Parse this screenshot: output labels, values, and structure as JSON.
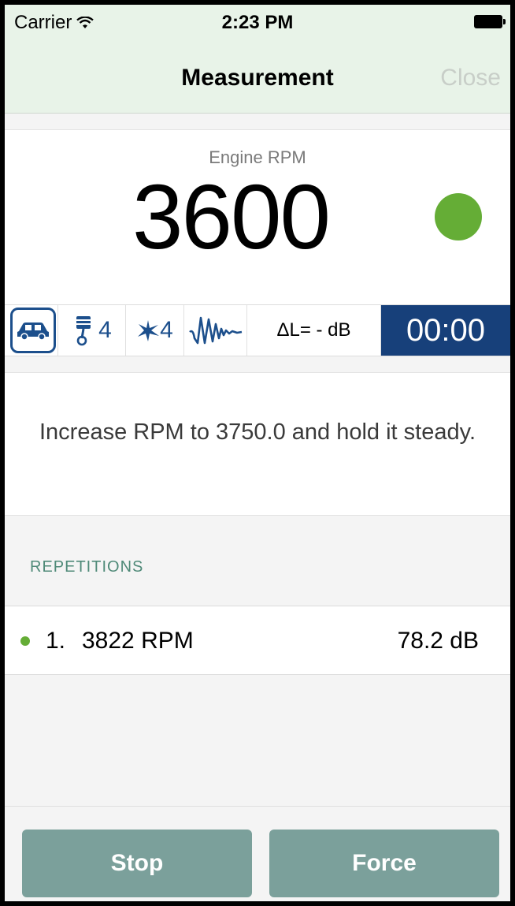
{
  "status_bar": {
    "carrier": "Carrier",
    "time": "2:23 PM"
  },
  "nav": {
    "title": "Measurement",
    "close_label": "Close"
  },
  "engine": {
    "label": "Engine RPM",
    "value": "3600",
    "status_color": "#65ad36"
  },
  "toolbar": {
    "vehicle_icon": "car-icon",
    "cylinders": "4",
    "cylinders_icon": "piston-icon",
    "ignitions": "4",
    "ignitions_icon": "spark-icon",
    "waveform_icon": "waveform-icon",
    "delta_level": "ΔL= - dB",
    "timer": "00:00",
    "accent_color": "#1c4f8c",
    "timer_bg": "#17407a"
  },
  "instruction": {
    "text": "Increase RPM to 3750.0 and hold it steady."
  },
  "repetitions": {
    "header": "REPETITIONS",
    "items": [
      {
        "index": "1.",
        "rpm": "3822 RPM",
        "level": "78.2 dB"
      }
    ]
  },
  "buttons": {
    "stop": "Stop",
    "force": "Force",
    "color": "#7ba09b"
  }
}
